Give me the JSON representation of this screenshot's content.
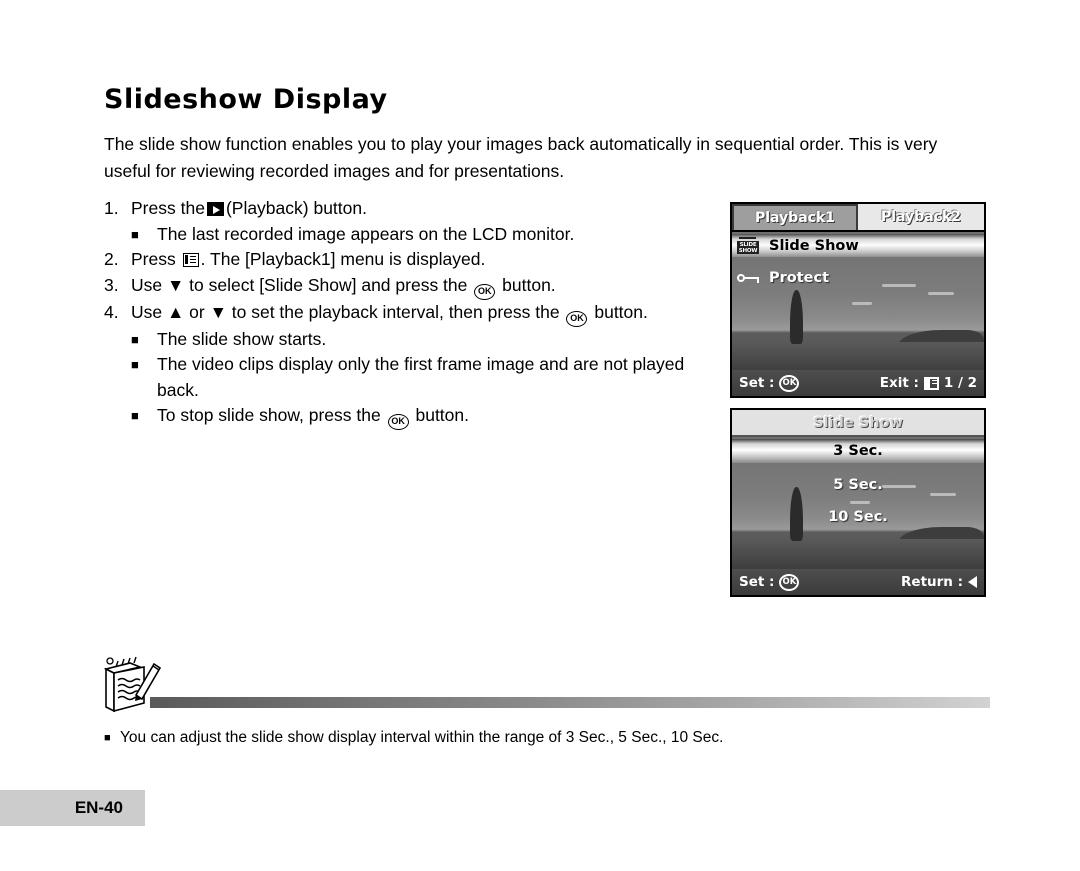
{
  "page": {
    "title": "Slideshow Display",
    "intro": "The slide show function enables you to play your images back automatically in sequential order. This is very useful for reviewing recorded images and for presentations.",
    "footer_page_label": "EN-40"
  },
  "steps": [
    {
      "num": "1.",
      "text_before": "Press the",
      "icon": "playback-icon",
      "text_after": "(Playback) button.",
      "subs": [
        "The last recorded image appears on the LCD monitor."
      ]
    },
    {
      "num": "2.",
      "text_before": "Press",
      "icon": "menu-icon",
      "text_after": ". The [Playback1] menu is displayed.",
      "subs": []
    },
    {
      "num": "3.",
      "text_before": "Use ▼ to select [Slide Show] and press the",
      "icon": "ok-icon",
      "text_after": "button.",
      "subs": []
    },
    {
      "num": "4.",
      "text_before": "Use ▲ or ▼ to set the playback interval, then press the",
      "icon": "ok-icon",
      "text_after": "button.",
      "subs": [
        "The slide show starts.",
        "The video clips display only  the first frame image and are not played back.",
        "To stop slide show, press the OK button."
      ]
    }
  ],
  "step4_last_sub": {
    "before": "To stop slide show, press the",
    "icon": "ok-icon",
    "after": "button."
  },
  "lcd_playback": {
    "tabs": [
      {
        "label": "Playback1",
        "active": true
      },
      {
        "label": "Playback2",
        "active": false
      }
    ],
    "menu_items": [
      {
        "label": "Slide Show",
        "icon": "slideshow-icon",
        "selected": true
      },
      {
        "label": "Protect",
        "icon": "key-icon",
        "selected": false
      }
    ],
    "bottom_left_label": "Set :",
    "bottom_left_icon_text": "OK",
    "bottom_right_label": "Exit :",
    "bottom_right_icon": "menu-icon",
    "page_indicator": "1 / 2"
  },
  "lcd_slideshow": {
    "title": "Slide Show",
    "options": [
      {
        "label": "3 Sec.",
        "selected": true
      },
      {
        "label": "5 Sec.",
        "selected": false
      },
      {
        "label": "10 Sec.",
        "selected": false
      }
    ],
    "bottom_left_label": "Set :",
    "bottom_left_icon_text": "OK",
    "bottom_right_label": "Return :",
    "bottom_right_icon": "left-arrow-icon"
  },
  "note": {
    "bullet": "■",
    "text": "You can adjust the slide show display interval within the range of 3 Sec., 5 Sec., 10 Sec."
  },
  "colors": {
    "footer_bg": "#cccccc",
    "lcd_frame": "#000000",
    "highlight": "#ffffff"
  }
}
